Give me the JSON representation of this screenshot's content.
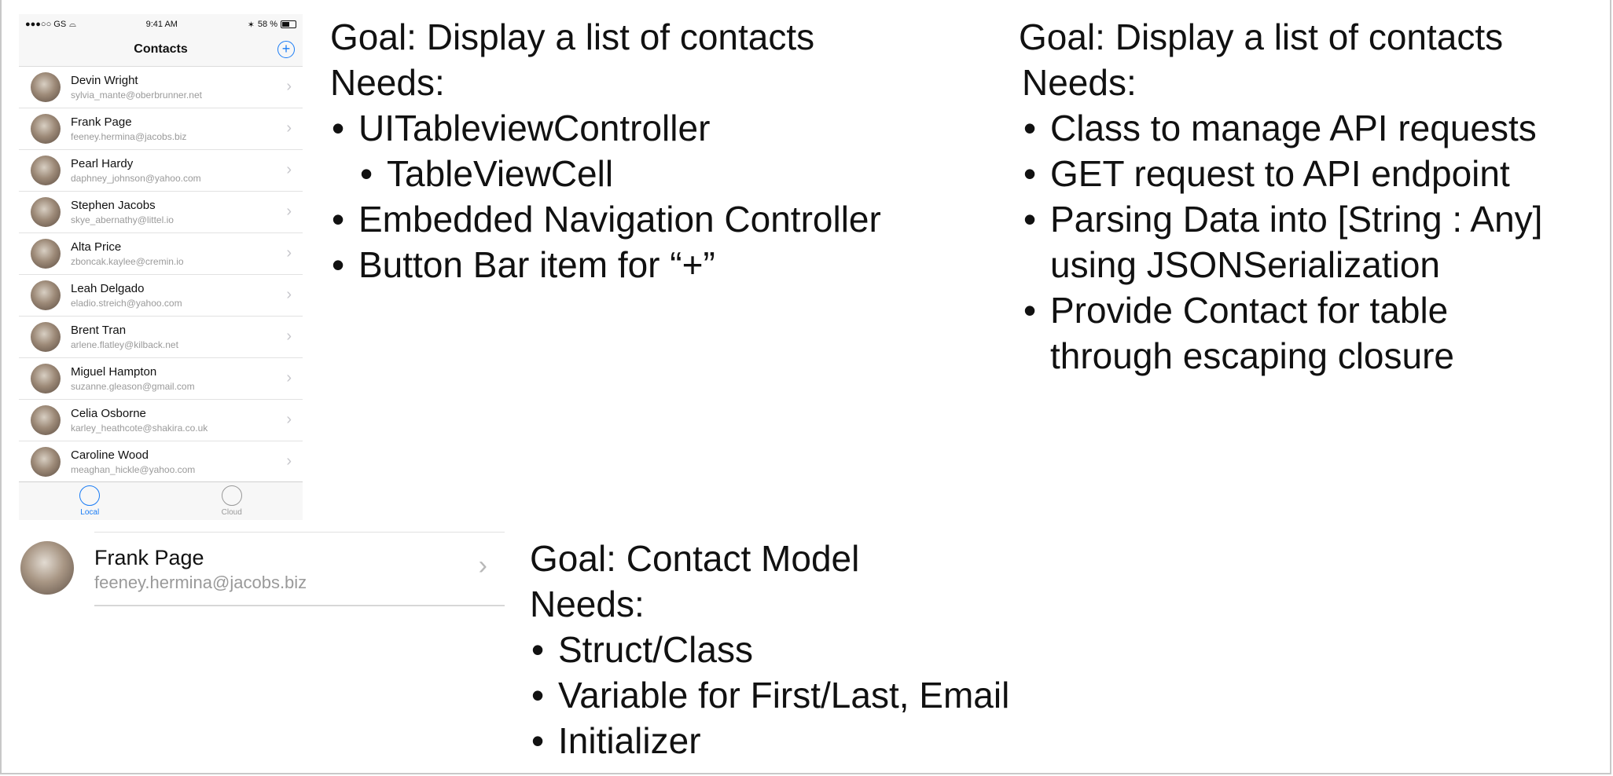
{
  "phone": {
    "status": {
      "carrier": "●●●○○ GS",
      "time": "9:41 AM",
      "battery": "58 %"
    },
    "nav": {
      "title": "Contacts",
      "add_symbol": "+"
    },
    "contacts": [
      {
        "name": "Devin Wright",
        "email": "sylvia_mante@oberbrunner.net"
      },
      {
        "name": "Frank Page",
        "email": "feeney.hermina@jacobs.biz"
      },
      {
        "name": "Pearl Hardy",
        "email": "daphney_johnson@yahoo.com"
      },
      {
        "name": "Stephen Jacobs",
        "email": "skye_abernathy@littel.io"
      },
      {
        "name": "Alta Price",
        "email": "zboncak.kaylee@cremin.io"
      },
      {
        "name": "Leah Delgado",
        "email": "eladio.streich@yahoo.com"
      },
      {
        "name": "Brent Tran",
        "email": "arlene.flatley@kilback.net"
      },
      {
        "name": "Miguel Hampton",
        "email": "suzanne.gleason@gmail.com"
      },
      {
        "name": "Celia Osborne",
        "email": "karley_heathcote@shakira.co.uk"
      },
      {
        "name": "Caroline Wood",
        "email": "meaghan_hickle@yahoo.com"
      }
    ],
    "tabs": [
      {
        "label": "Local"
      },
      {
        "label": "Cloud"
      }
    ],
    "chevron": "›"
  },
  "big_cell": {
    "name": "Frank Page",
    "email": "feeney.hermina@jacobs.biz",
    "chevron": "›"
  },
  "blocks": {
    "left": {
      "goal": "Goal: Display a list of contacts",
      "needs": "Needs:",
      "items": [
        "UITableviewController",
        "TableViewCell",
        "Embedded Navigation Controller",
        "Button Bar item for “+”"
      ]
    },
    "right": {
      "goal": "Goal: Display a list of contacts",
      "needs": "Needs:",
      "items": [
        "Class to manage API requests",
        "GET request to API endpoint",
        "Parsing Data into [String : Any] using JSONSerialization",
        "Provide Contact for table through escaping closure"
      ]
    },
    "bottom": {
      "goal": "Goal: Contact Model",
      "needs": "Needs:",
      "items": [
        "Struct/Class",
        "Variable for First/Last, Email",
        "Initializer"
      ]
    }
  }
}
